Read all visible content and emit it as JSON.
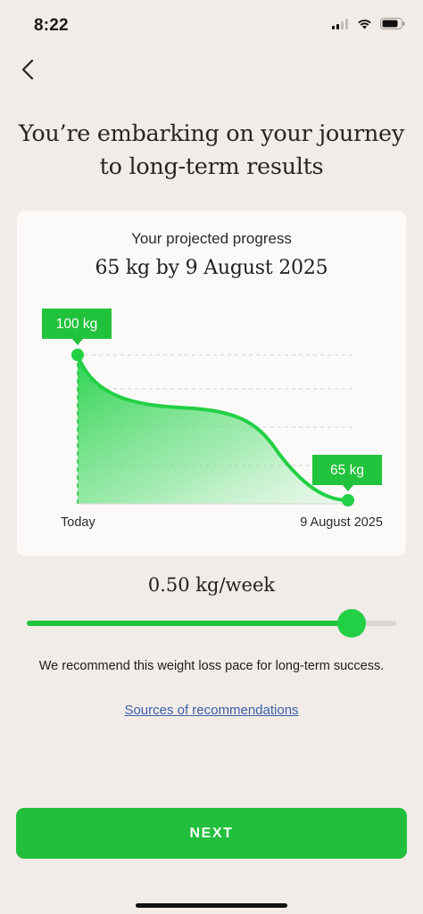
{
  "status_bar": {
    "time": "8:22",
    "battery_fraction": 0.85
  },
  "headline": {
    "line1": "You’re embarking on your journey",
    "line2": "to long-term results"
  },
  "card": {
    "subtitle": "Your projected progress",
    "title": "65 kg by 9 August 2025"
  },
  "chart_data": {
    "type": "area",
    "x": [
      "Today",
      "9 August 2025"
    ],
    "start": {
      "label": "100 kg",
      "value": 100
    },
    "end": {
      "label": "65 kg",
      "value": 65
    },
    "x_labels": [
      "Today",
      "9 August 2025"
    ],
    "grid": true,
    "colors": {
      "line": "#22d046",
      "fill": "#22d046",
      "tag": "#22c33c"
    }
  },
  "pace": {
    "label": "0.50 kg/week",
    "slider_fraction": 0.88
  },
  "recommendation": "We recommend this weight loss pace for long-term success.",
  "sources_link": "Sources of recommendations",
  "next_button": "NEXT",
  "colors": {
    "accent": "#22bf3d",
    "background": "#f1ece7",
    "link": "#3b5ea9"
  }
}
